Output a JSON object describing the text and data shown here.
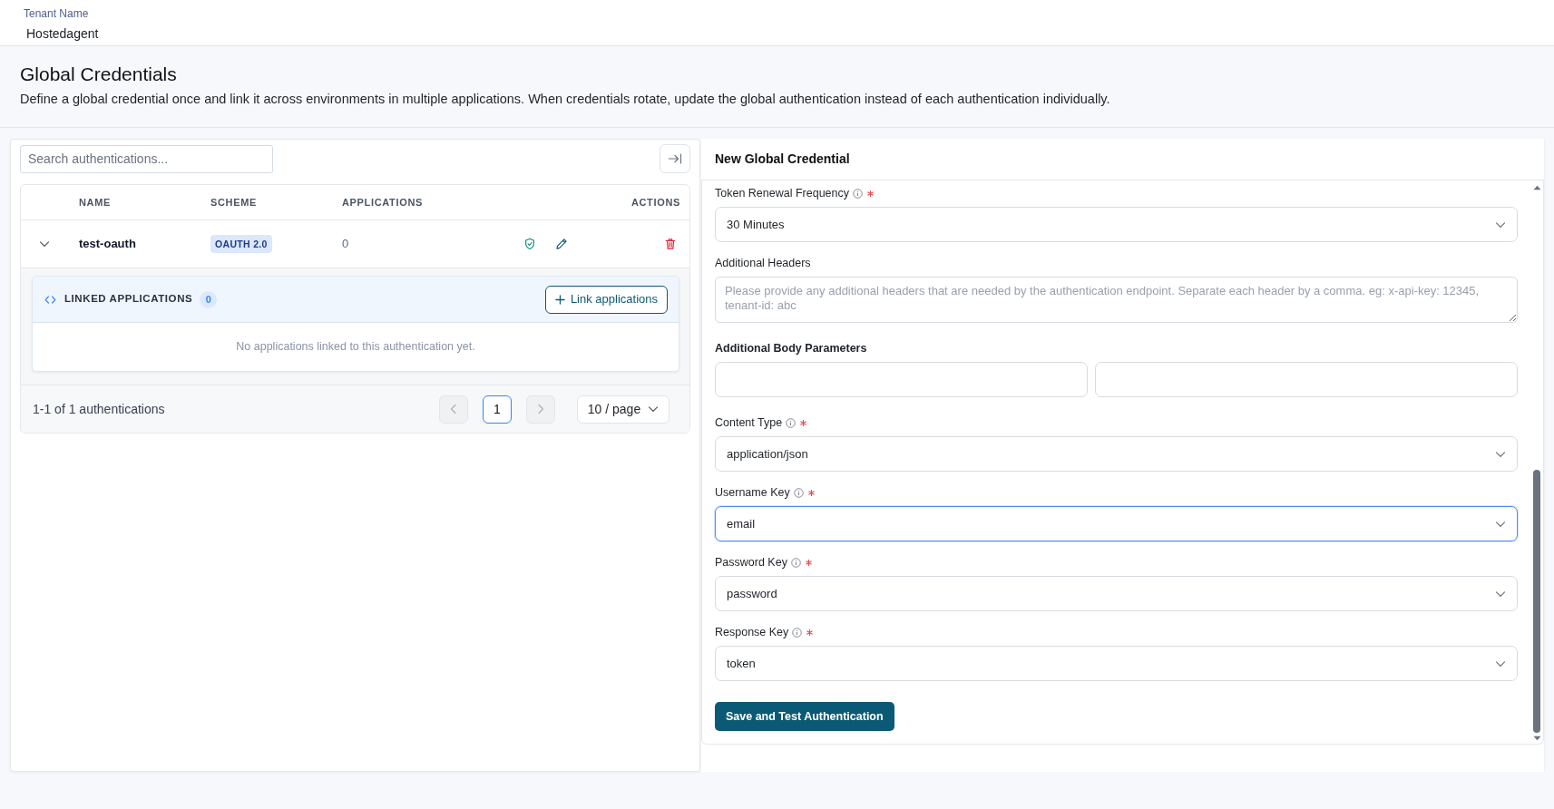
{
  "header": {
    "label": "Tenant Name",
    "tenant": "Hostedagent"
  },
  "intro": {
    "title": "Global Credentials",
    "description": "Define a global credential once and link it across environments in multiple applications. When credentials rotate, update the global authentication instead of each authentication individually."
  },
  "list_panel": {
    "search": {
      "placeholder": "Search authentications..."
    },
    "table": {
      "columns": [
        "NAME",
        "SCHEME",
        "APPLICATIONS",
        "ACTIONS"
      ],
      "rows": [
        {
          "name": "test-oauth",
          "scheme": "OAUTH 2.0",
          "applications": "0",
          "expanded": true,
          "linked_applications": {
            "title": "LINKED APPLICATIONS",
            "count": "0",
            "button": "Link applications",
            "empty_message": "No applications linked to this authentication yet."
          }
        }
      ]
    },
    "pagination": {
      "summary": "1-1 of 1 authentications",
      "previous": {
        "disabled": true
      },
      "pages": [
        {
          "label": "1",
          "selected": true
        }
      ],
      "next": {
        "disabled": true
      },
      "page_size": "10 / page"
    }
  },
  "form": {
    "title": "New Global Credential",
    "fields": [
      {
        "kind": "select",
        "label": "Token Renewal Frequency",
        "info": true,
        "required": true,
        "value": "30 Minutes",
        "focused": false
      },
      {
        "kind": "textarea",
        "label": "Additional Headers",
        "info": false,
        "required": false,
        "placeholder": "Please provide any additional headers that are needed by the authentication endpoint. Separate each header by a comma. eg: x-api-key: 12345, tenant-id: abc",
        "focused": false
      },
      {
        "kind": "pair",
        "label": "Additional Body Parameters",
        "info": false,
        "required": false,
        "focused": false
      },
      {
        "kind": "select",
        "label": "Content Type",
        "info": true,
        "required": true,
        "value": "application/json",
        "focused": false
      },
      {
        "kind": "select",
        "label": "Username Key",
        "info": true,
        "required": true,
        "value": "email",
        "focused": true
      },
      {
        "kind": "select",
        "label": "Password Key",
        "info": true,
        "required": true,
        "value": "password",
        "focused": false
      },
      {
        "kind": "select",
        "label": "Response Key",
        "info": true,
        "required": true,
        "value": "token",
        "focused": false
      }
    ],
    "submit": "Save and Test Authentication"
  }
}
